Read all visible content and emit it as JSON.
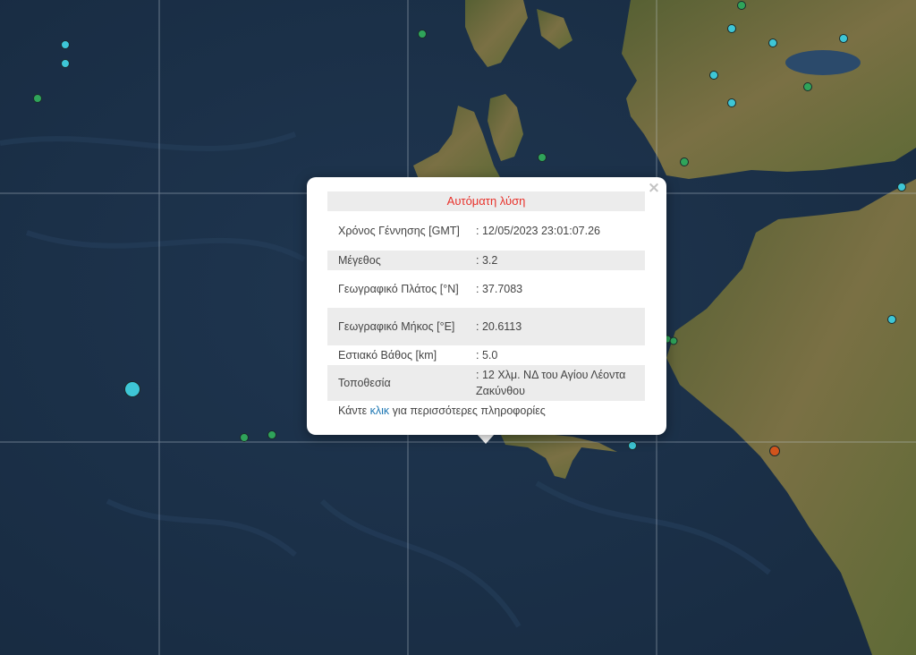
{
  "popup": {
    "header": "Αυτόματη λύση",
    "rows": [
      {
        "label": "Χρόνος Γέννησης [GMT]",
        "value": ": 12/05/2023 23:01:07.26"
      },
      {
        "label": "Μέγεθος",
        "value": ": 3.2"
      },
      {
        "label": "Γεωγραφικό Πλάτος [°N]",
        "value": ": 37.7083"
      },
      {
        "label": "Γεωγραφικό Μήκος [°E]",
        "value": ": 20.6113"
      },
      {
        "label": "Εστιακό Βάθος [km]",
        "value": ": 5.0"
      },
      {
        "label": "Τοποθεσία",
        "value": ": 12 Χλμ. ΝΔ του Αγίου Λέοντα Ζακύνθου"
      }
    ],
    "more_prefix": "Κάντε",
    "more_link": "κλικ",
    "more_suffix": "για περισσότερες πληροφορίες",
    "close": "×"
  },
  "colors": {
    "sea": "#1d3049",
    "land": "#6b6a3c",
    "marker_cyan": "#3ec6d6",
    "marker_green": "#2fa45a",
    "marker_orange": "#d2541c",
    "header_text": "#e8312a",
    "link": "#1f78b4"
  }
}
